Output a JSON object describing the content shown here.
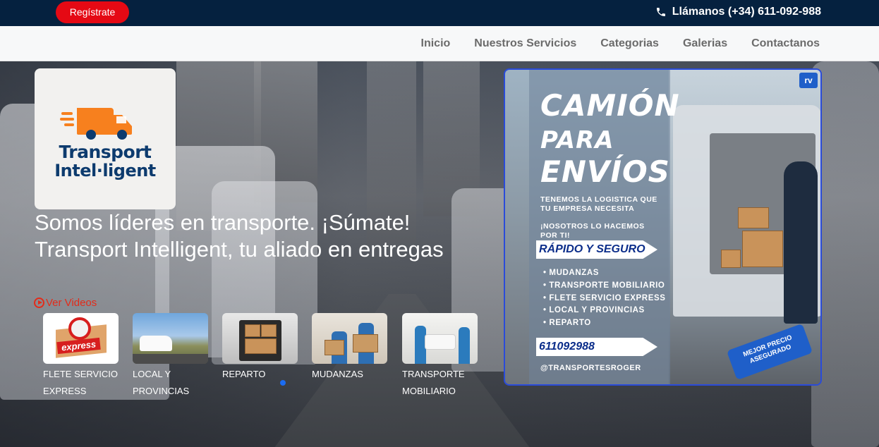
{
  "topbar": {
    "register_label": "Regístrate",
    "phone_label": "Llámanos (+34) 611-092-988"
  },
  "nav": {
    "items": [
      "Inicio",
      "Nuestros Servicios",
      "Categorias",
      "Galerias",
      "Contactanos"
    ]
  },
  "hero": {
    "logo": {
      "line1": "Transport",
      "line2": "Intel·ligent"
    },
    "headline": "Somos líderes en transporte. ¡Súmate! Transport Intelligent, tu aliado en entregas",
    "video_link": "Ver Videos",
    "services": [
      {
        "label": "FLETE SERVICIO EXPRESS"
      },
      {
        "label": "LOCAL Y PROVINCIAS"
      },
      {
        "label": "REPARTO"
      },
      {
        "label": "MUDANZAS"
      },
      {
        "label": "TRANSPORTE MOBILIARIO"
      }
    ],
    "thumb_express_text": "express"
  },
  "ad": {
    "title_1": "CAMIÓN",
    "title_2": "PARA",
    "title_3": "ENVÍOS",
    "subtitle_1": "TENEMOS LA LOGISTICA QUE TU EMPRESA NECESITA",
    "subtitle_2": "¡NOSOTROS LO HACEMOS POR TI!",
    "banner": "RÁPIDO Y SEGURO",
    "list": [
      "MUDANZAS",
      "TRANSPORTE MOBILIARIO",
      "FLETE SERVICIO EXPRESS",
      "LOCAL Y PROVINCIAS",
      "REPARTO"
    ],
    "phone": "611092988",
    "handle": "@TRANSPORTESROGER",
    "tag": "MEJOR PRECIO ASEGURADO",
    "logo": "rv"
  },
  "colors": {
    "topbar_bg": "#05213f",
    "register_bg": "#e50914",
    "nav_text": "#6b6b6b",
    "logo_orange": "#f7801e",
    "logo_blue": "#0d3b6e",
    "video_link": "#e32b1a",
    "carousel_dot": "#1b6cf2"
  }
}
